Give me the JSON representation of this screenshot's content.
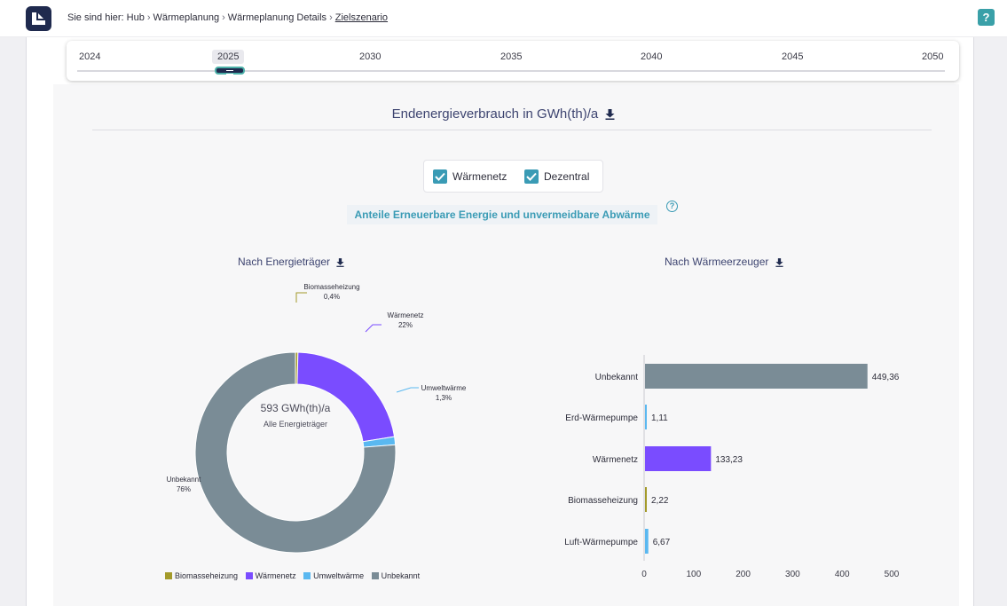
{
  "breadcrumb": {
    "prefix": "Sie sind hier:",
    "items": [
      "Hub",
      "Wärmeplanung",
      "Wärmeplanung Details"
    ],
    "current": "Zielszenario"
  },
  "help_button": "?",
  "timeline": {
    "years": [
      "2024",
      "2025",
      "2030",
      "2035",
      "2040",
      "2045",
      "2050"
    ],
    "selected": "2025"
  },
  "section_title": "Endenergieverbrauch in GWh(th)/a",
  "filters": [
    {
      "label": "Wärmenetz",
      "checked": true
    },
    {
      "label": "Dezentral",
      "checked": true
    }
  ],
  "renewables_link": "Anteile Erneuerbare Energie und unvermeidbare Abwärme",
  "colors": {
    "Biomasseheizung": "#a39a2a",
    "Wärmenetz": "#7a4cff",
    "Umweltwärme": "#5ab8f0",
    "Unbekannt": "#7a8c96",
    "Erd-Wärmepumpe": "#5ab8f0",
    "Luft-Wärmepumpe": "#5ab8f0"
  },
  "chart_data": [
    {
      "type": "pie",
      "title": "Nach Energieträger",
      "center_value": "593 GWh(th)/a",
      "center_label": "Alle Energieträger",
      "categories": [
        "Biomasseheizung",
        "Wärmenetz",
        "Umweltwärme",
        "Unbekannt"
      ],
      "values": [
        0.4,
        22,
        1.3,
        76
      ],
      "value_labels": [
        "0,4%",
        "22%",
        "1,3%",
        "76%"
      ],
      "legend": [
        "Biomasseheizung",
        "Wärmenetz",
        "Umweltwärme",
        "Unbekannt"
      ]
    },
    {
      "type": "bar",
      "title": "Nach Wärmeerzeuger",
      "orientation": "horizontal",
      "categories": [
        "Unbekannt",
        "Erd-Wärmepumpe",
        "Wärmenetz",
        "Biomasseheizung",
        "Luft-Wärmepumpe"
      ],
      "values": [
        449.36,
        1.11,
        133.23,
        2.22,
        6.67
      ],
      "value_labels": [
        "449,36",
        "1,11",
        "133,23",
        "2,22",
        "6,67"
      ],
      "xticks": [
        "0",
        "100",
        "200",
        "300",
        "400",
        "500"
      ],
      "xlim": [
        0,
        500
      ]
    }
  ]
}
